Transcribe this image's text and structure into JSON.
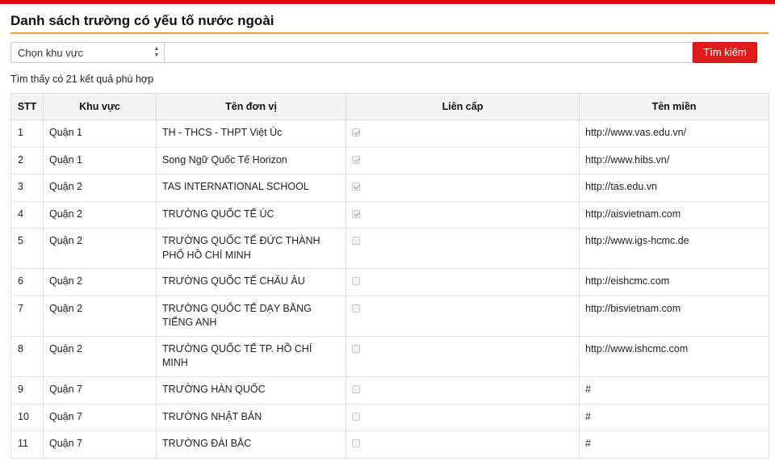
{
  "page": {
    "title": "Danh sách trường có yếu tố nước ngoài",
    "region_select": "Chọn khu vực",
    "search_value": "",
    "search_button": "Tìm kiếm",
    "result_text": "Tìm thấy có 21 kết quả phù hợp"
  },
  "table": {
    "headers": [
      "STT",
      "Khu vực",
      "Tên đơn vị",
      "Liên cấp",
      "Tên miền"
    ],
    "rows": [
      {
        "stt": "1",
        "region": "Quận 1",
        "name": "TH - THCS - THPT Việt Úc",
        "lien_cap": true,
        "domain": "http://www.vas.edu.vn/"
      },
      {
        "stt": "2",
        "region": "Quận 1",
        "name": "Song Ngữ Quốc Tế Horizon",
        "lien_cap": true,
        "domain": "http://www.hibs.vn/"
      },
      {
        "stt": "3",
        "region": "Quận 2",
        "name": "TAS INTERNATIONAL SCHOOL",
        "lien_cap": true,
        "domain": "http://tas.edu.vn"
      },
      {
        "stt": "4",
        "region": "Quận 2",
        "name": "TRƯỜNG QUỐC TẾ ÚC",
        "lien_cap": true,
        "domain": "http://aisvietnam.com"
      },
      {
        "stt": "5",
        "region": "Quận 2",
        "name": "TRƯỜNG QUỐC TẾ ĐỨC THÀNH PHỐ HỒ CHÍ MINH",
        "lien_cap": false,
        "domain": "http://www.igs-hcmc.de"
      },
      {
        "stt": "6",
        "region": "Quận 2",
        "name": "TRƯỜNG QUỐC TẾ CHÂU ÂU",
        "lien_cap": false,
        "domain": "http://eishcmc.com"
      },
      {
        "stt": "7",
        "region": "Quận 2",
        "name": "TRƯỜNG QUỐC TẾ DẠY BẰNG TIẾNG ANH",
        "lien_cap": false,
        "domain": "http://bisvietnam.com"
      },
      {
        "stt": "8",
        "region": "Quận 2",
        "name": "TRƯỜNG QUỐC TẾ TP. HỒ CHÍ MINH",
        "lien_cap": false,
        "domain": "http://www.ishcmc.com"
      },
      {
        "stt": "9",
        "region": "Quận 7",
        "name": "TRƯỜNG HÀN QUỐC",
        "lien_cap": false,
        "domain": "#"
      },
      {
        "stt": "10",
        "region": "Quận 7",
        "name": "TRƯỜNG NHẬT BẢN",
        "lien_cap": false,
        "domain": "#"
      },
      {
        "stt": "11",
        "region": "Quận 7",
        "name": "TRƯỜNG ĐÀI BẮC",
        "lien_cap": false,
        "domain": "#"
      }
    ]
  },
  "colors": {
    "top_bar": "#e3050e",
    "title_underline": "#f0a02a",
    "search_button_bg": "#e01b1b"
  }
}
